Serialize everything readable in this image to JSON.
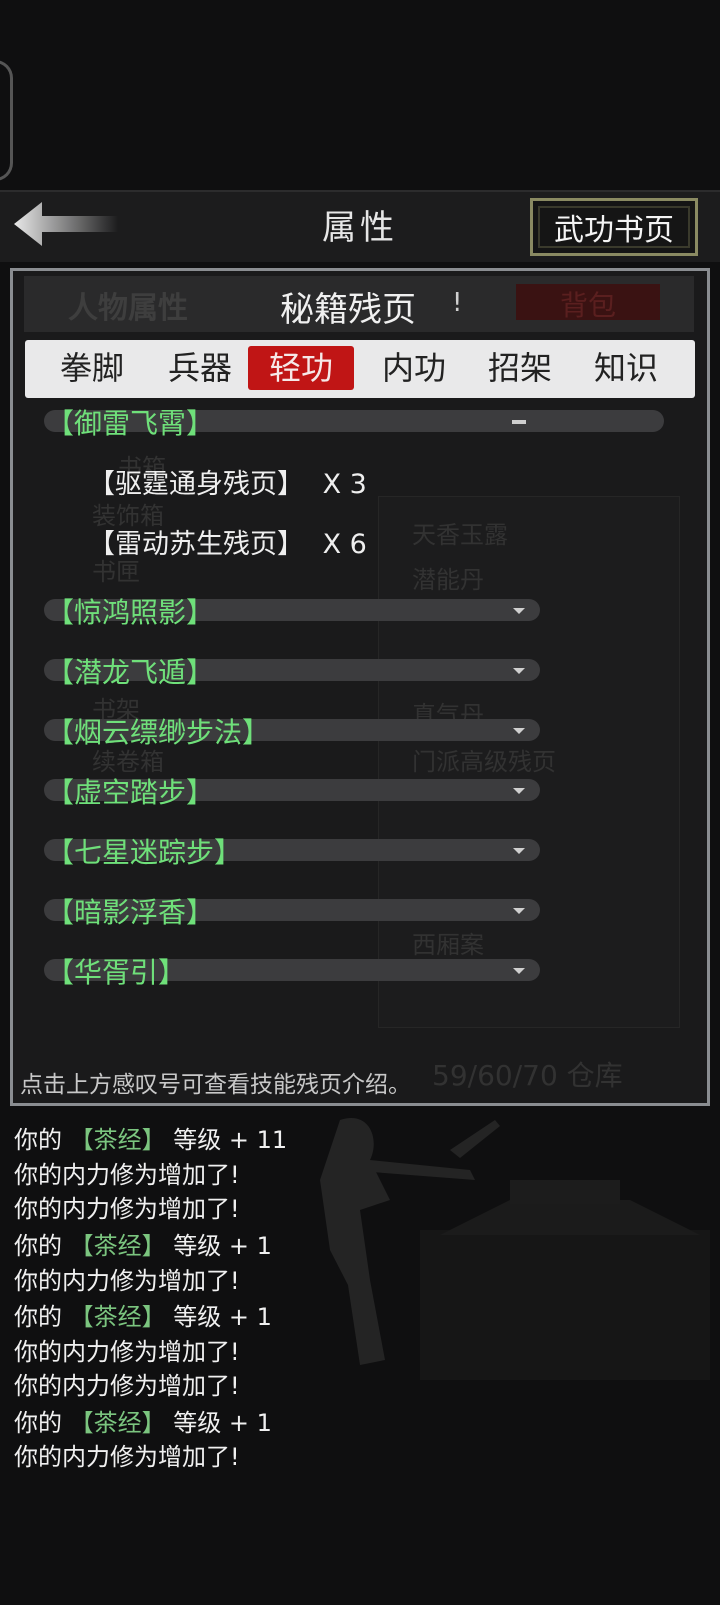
{
  "header": {
    "title": "属性",
    "right_button": "武功书页"
  },
  "panel": {
    "title": "秘籍残页",
    "info_mark": "!",
    "bg_left_tab": "人物属性",
    "bg_right_tab": "背包",
    "bg_ghost_text": [
      "书箱",
      "装饰箱",
      "书匣",
      "书架",
      "续卷箱",
      "天香玉露",
      "潜能丹",
      "真气丹",
      "门派高级残页",
      "西厢案",
      "59/60/70 仓库"
    ]
  },
  "tabs": [
    {
      "label": "拳脚",
      "active": false
    },
    {
      "label": "兵器",
      "active": false
    },
    {
      "label": "轻功",
      "active": true
    },
    {
      "label": "内功",
      "active": false
    },
    {
      "label": "招架",
      "active": false
    },
    {
      "label": "知识",
      "active": false
    }
  ],
  "skills": [
    {
      "name": "【御雷飞霄】",
      "expanded": true,
      "pages": [
        {
          "name": "【驱霆通身残页】",
          "count": "X 3"
        },
        {
          "name": "【雷动苏生残页】",
          "count": "X 6"
        }
      ]
    },
    {
      "name": "【惊鸿照影】",
      "expanded": false
    },
    {
      "name": "【潜龙飞遁】",
      "expanded": false
    },
    {
      "name": "【烟云缥缈步法】",
      "expanded": false
    },
    {
      "name": "【虚空踏步】",
      "expanded": false
    },
    {
      "name": "【七星迷踪步】",
      "expanded": false
    },
    {
      "name": "【暗影浮香】",
      "expanded": false
    },
    {
      "name": "【华胥引】",
      "expanded": false
    }
  ],
  "hint": "点击上方感叹号可查看技能残页介绍。",
  "log": [
    {
      "prefix": "你的",
      "item": "【茶经】",
      "suffix": "等级 + 11"
    },
    {
      "text": "你的内力修为增加了!"
    },
    {
      "text": "你的内力修为增加了!"
    },
    {
      "prefix": "你的",
      "item": "【茶经】",
      "suffix": "等级 + 1"
    },
    {
      "text": "你的内力修为增加了!"
    },
    {
      "prefix": "你的",
      "item": "【茶经】",
      "suffix": "等级 + 1"
    },
    {
      "text": "你的内力修为增加了!"
    },
    {
      "text": "你的内力修为增加了!"
    },
    {
      "prefix": "你的",
      "item": "【茶经】",
      "suffix": "等级 + 1"
    },
    {
      "text": "你的内力修为增加了!"
    }
  ],
  "colors": {
    "accent_red": "#c01515",
    "skill_green": "#6fe07a",
    "log_item_green": "#7bc57f",
    "button_border": "#8a8a62"
  },
  "icons": {
    "back": "back-arrow-icon",
    "expand": "chevron-down-icon",
    "collapse": "minus-icon"
  }
}
